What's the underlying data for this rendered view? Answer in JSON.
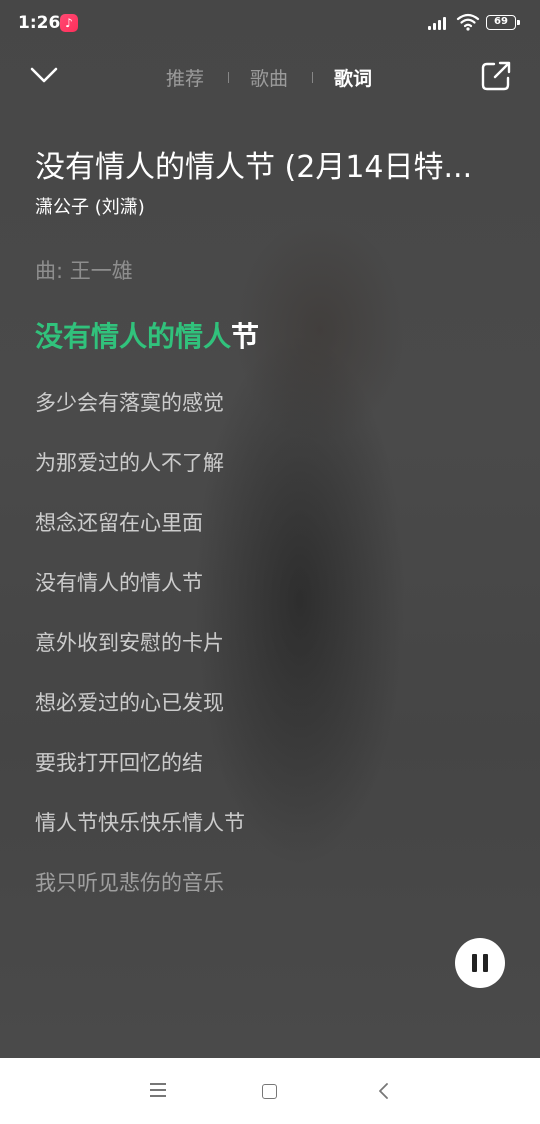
{
  "status_bar": {
    "time": "1:26",
    "app_icon": "music-note-icon",
    "battery": "69"
  },
  "nav": {
    "tabs": [
      {
        "label": "推荐",
        "active": false
      },
      {
        "label": "歌曲",
        "active": false
      },
      {
        "label": "歌词",
        "active": true
      }
    ]
  },
  "song": {
    "title": "没有情人的情人节 (2月14日特...",
    "artist": "潇公子 (刘潇)"
  },
  "lyrics": {
    "composer_line": "曲: 王一雄",
    "current_line_sung": "没有情人的情人",
    "current_line_rest": "节",
    "lines": [
      "多少会有落寞的感觉",
      "为那爱过的人不了解",
      "想念还留在心里面",
      "没有情人的情人节",
      "意外收到安慰的卡片",
      "想必爱过的心已发现",
      "要我打开回忆的结",
      "情人节快乐快乐情人节",
      "我只听见悲伤的音乐"
    ]
  },
  "colors": {
    "accent": "#31c27c",
    "background": "#474747"
  }
}
